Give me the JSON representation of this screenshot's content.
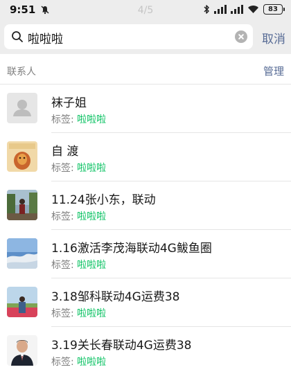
{
  "status_bar": {
    "time": "9:51",
    "page_indicator": "4/5",
    "battery": "83",
    "icons": [
      "mute-icon",
      "bluetooth-icon",
      "signal-icon",
      "signal-icon",
      "wifi-icon",
      "battery-icon"
    ]
  },
  "search": {
    "query": "啦啦啦",
    "cancel_label": "取消"
  },
  "section": {
    "title": "联系人",
    "manage_label": "管理"
  },
  "tag_prefix": "标签:",
  "contacts": [
    {
      "name": "袜子姐",
      "tag": "啦啦啦"
    },
    {
      "name": "自 渡",
      "tag": "啦啦啦"
    },
    {
      "name": "11.24张小东，联动",
      "tag": "啦啦啦"
    },
    {
      "name": "1.16激活李茂海联动4G鲅鱼圈",
      "tag": "啦啦啦"
    },
    {
      "name": "3.18邹科联动4G运费38",
      "tag": "啦啦啦"
    },
    {
      "name": "3.19关长春联动4G运费38",
      "tag": "啦啦啦"
    }
  ],
  "colors": {
    "header_bg": "#ededed",
    "link": "#576b95",
    "tag_green": "#07c160",
    "muted": "#7f7f7f"
  }
}
